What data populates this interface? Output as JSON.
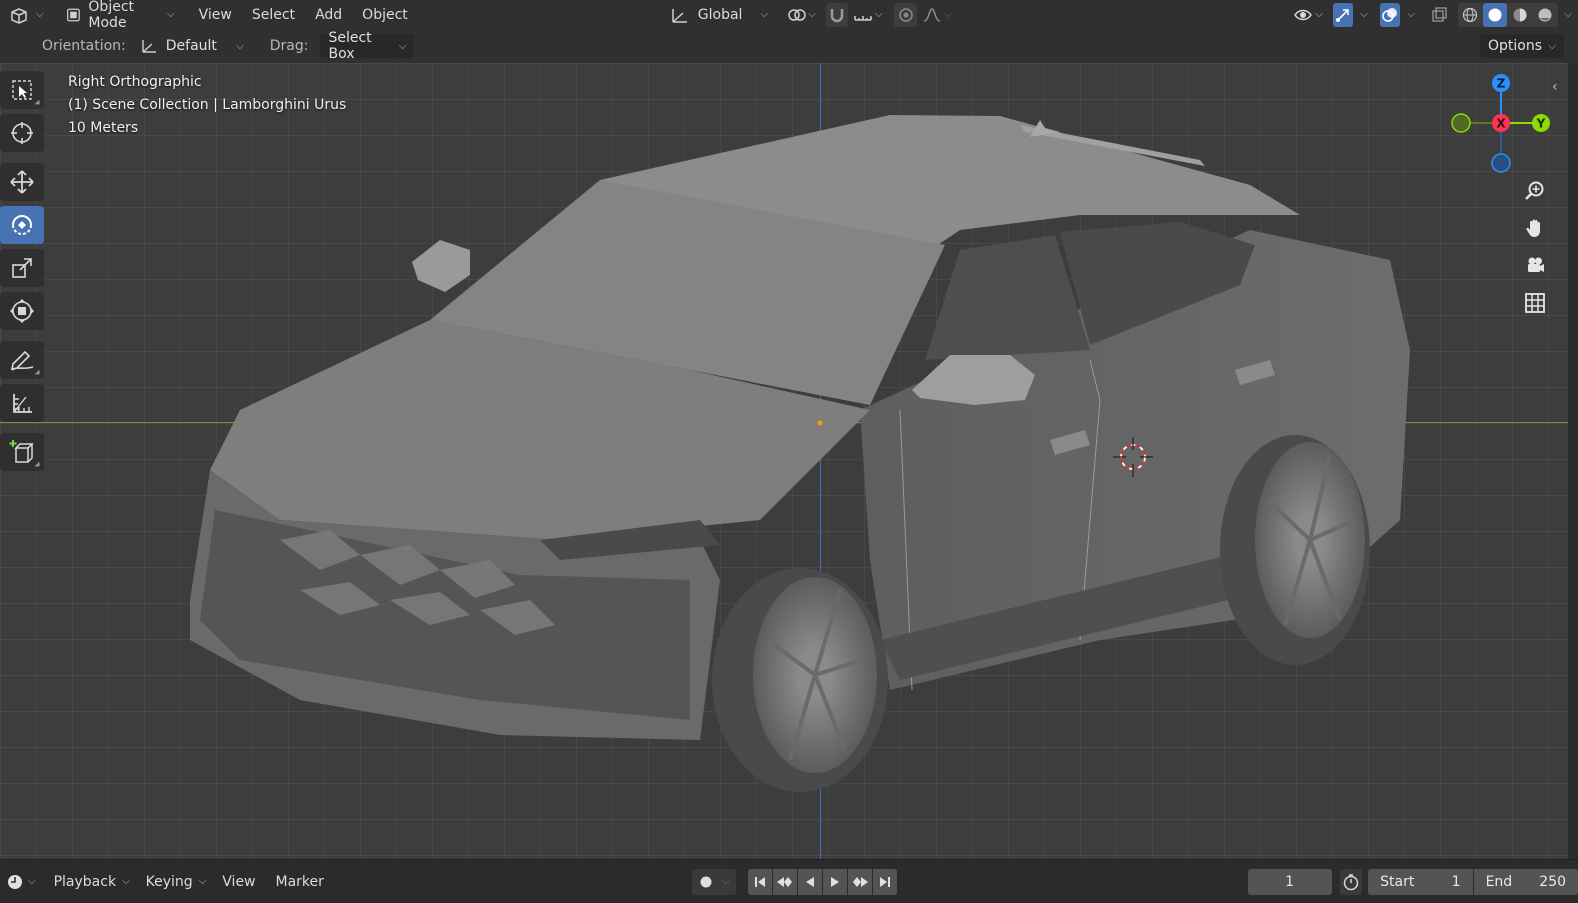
{
  "header": {
    "editor_type_icon": "3d-viewport-icon",
    "mode": "Object Mode",
    "menus": [
      "View",
      "Select",
      "Add",
      "Object"
    ],
    "transform_orientation": "Global",
    "shading_modes": [
      "wireframe",
      "solid",
      "material-preview",
      "rendered"
    ],
    "active_shading": "solid"
  },
  "tool_settings": {
    "orientation_label": "Orientation:",
    "orientation_value": "Default",
    "drag_label": "Drag:",
    "drag_value": "Select Box",
    "options_label": "Options"
  },
  "viewport": {
    "view_name": "Right Orthographic",
    "collection_info": "(1) Scene Collection | Lamborghini Urus",
    "scale_info": "10 Meters",
    "axis_labels": {
      "z": "Z",
      "x": "X",
      "y": "Y"
    },
    "colors": {
      "x_axis": "#ff3352",
      "y_axis": "#8bdc00",
      "z_axis": "#2890ff",
      "active_tool": "#4772b3"
    }
  },
  "left_toolbar": {
    "tools": [
      "select-box",
      "cursor",
      "move",
      "rotate",
      "scale",
      "transform",
      "annotate",
      "measure",
      "add-cube"
    ],
    "active_tool": "rotate"
  },
  "timeline": {
    "menus": [
      "Playback",
      "Keying",
      "View",
      "Marker"
    ],
    "current_frame": "1",
    "start_label": "Start",
    "start_value": "1",
    "end_label": "End",
    "end_value": "250"
  }
}
